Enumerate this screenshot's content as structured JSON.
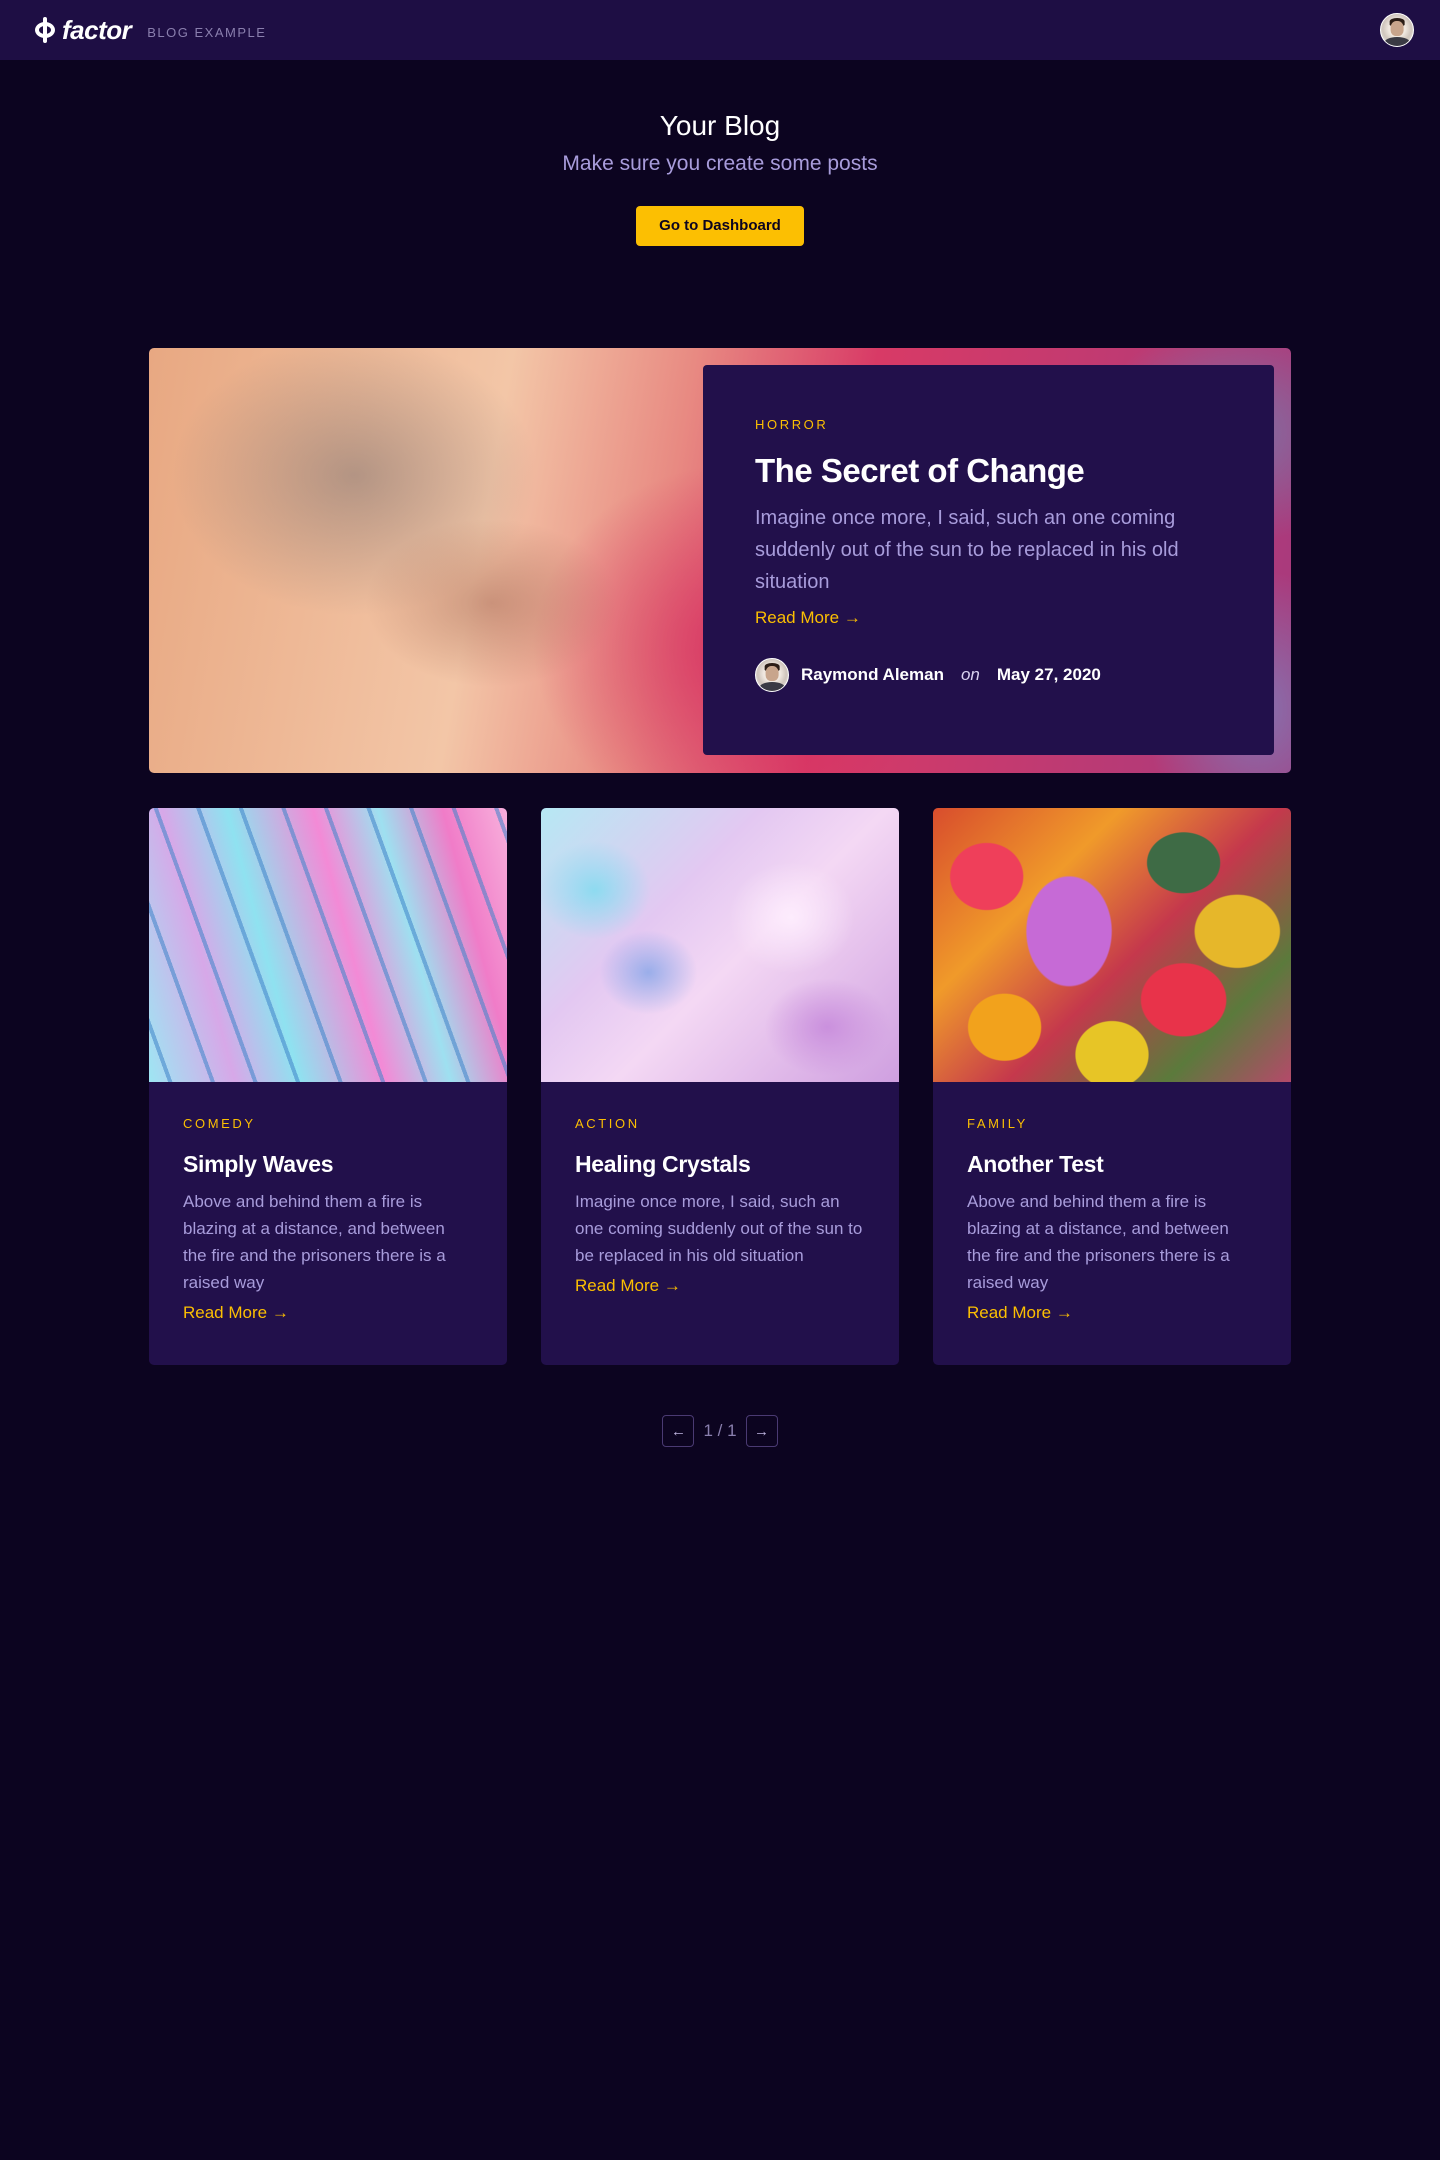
{
  "nav": {
    "logo_text": "factor",
    "site_tag": "BLOG EXAMPLE"
  },
  "hero": {
    "title": "Your Blog",
    "subtitle": "Make sure you create some posts",
    "button_label": "Go to Dashboard"
  },
  "featured": {
    "category": "HORROR",
    "title": "The Secret of Change",
    "excerpt": "Imagine once more, I said, such an one coming suddenly out of the sun to be replaced in his old situation",
    "read_more": "Read More →",
    "author": "Raymond Aleman",
    "on": "on",
    "date": "May 27, 2020"
  },
  "posts": [
    {
      "category": "COMEDY",
      "title": "Simply Waves",
      "excerpt": "Above and behind them a fire is blazing at a distance, and between the fire and the prisoners there is a raised way",
      "read_more": "Read More →"
    },
    {
      "category": "ACTION",
      "title": "Healing Crystals",
      "excerpt": "Imagine once more, I said, such an one coming suddenly out of the sun to be replaced in his old situation",
      "read_more": "Read More →"
    },
    {
      "category": "FAMILY",
      "title": "Another Test",
      "excerpt": "Above and behind them a fire is blazing at a distance, and between the fire and the prisoners there is a raised way",
      "read_more": "Read More →"
    }
  ],
  "pagination": {
    "prev_icon": "←",
    "next_icon": "→",
    "page_info": "1 / 1"
  },
  "colors": {
    "background": "#0c0420",
    "nav_background": "#1e0e44",
    "card_background": "#22104b",
    "accent": "#fcbf02",
    "muted_text": "#a89cdb"
  }
}
